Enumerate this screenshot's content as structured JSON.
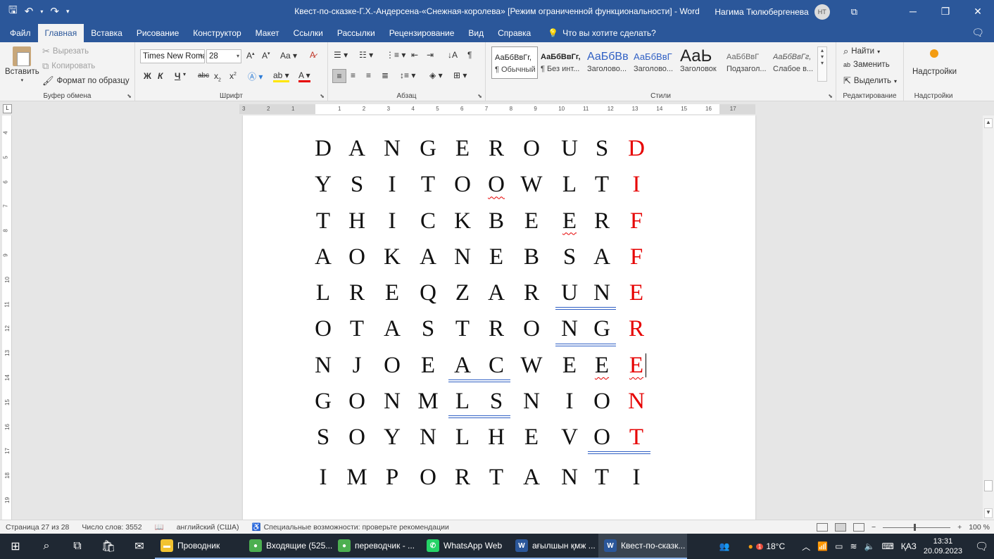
{
  "window": {
    "title": "Квест-по-сказке-Г.Х.-Андерсена-«Снежная-королева» [Режим ограниченной функциональности]  -  Word",
    "user_name": "Нагима Тюлюбергенева",
    "user_initials": "НТ"
  },
  "tabs": [
    "Файл",
    "Главная",
    "Вставка",
    "Рисование",
    "Конструктор",
    "Макет",
    "Ссылки",
    "Рассылки",
    "Рецензирование",
    "Вид",
    "Справка"
  ],
  "tell_me": "Что вы хотите сделать?",
  "clipboard": {
    "paste": "Вставить",
    "cut": "Вырезать",
    "copy": "Копировать",
    "format_painter": "Формат по образцу",
    "label": "Буфер обмена"
  },
  "font": {
    "name": "Times New Roman",
    "size": "28",
    "bold": "Ж",
    "italic": "К",
    "underline": "Ч",
    "strike": "abc",
    "label": "Шрифт"
  },
  "paragraph": {
    "label": "Абзац"
  },
  "styles": {
    "label": "Стили",
    "items": [
      {
        "sample": "АаБбВвГг,",
        "name": "¶ Обычный"
      },
      {
        "sample": "АаБбВвГг,",
        "name": "¶ Без инт..."
      },
      {
        "sample": "АаБбВв",
        "name": "Заголово..."
      },
      {
        "sample": "АаБбВвГ",
        "name": "Заголово..."
      },
      {
        "sample": "АаЬ",
        "name": "Заголовок"
      },
      {
        "sample": "АаБбВвГ",
        "name": "Подзагол..."
      },
      {
        "sample": "АаБбВвГг,",
        "name": "Слабое в..."
      }
    ]
  },
  "editing": {
    "find": "Найти",
    "replace": "Заменить",
    "select": "Выделить",
    "label": "Редактирование"
  },
  "addins": {
    "button": "Надстройки",
    "label": "Надстройки"
  },
  "ruler": {
    "top_ticks": [
      "3",
      "2",
      "1",
      "1",
      "2",
      "3",
      "4",
      "5",
      "6",
      "7",
      "8",
      "9",
      "10",
      "11",
      "12",
      "13",
      "14",
      "15",
      "16",
      "17"
    ],
    "left_ticks": [
      "4",
      "5",
      "6",
      "7",
      "8",
      "9",
      "10",
      "11",
      "12",
      "13",
      "14",
      "15",
      "16",
      "17",
      "18",
      "19"
    ]
  },
  "puzzle": {
    "rows": [
      [
        "D",
        "A",
        "N",
        "G",
        "E",
        "R",
        "O",
        "U",
        "S",
        "D"
      ],
      [
        "Y",
        "S",
        "I",
        "T",
        "O",
        "O",
        "W",
        "L",
        "T",
        "I"
      ],
      [
        "T",
        "H",
        "I",
        "C",
        "K",
        "B",
        "E",
        "E",
        "R",
        "F"
      ],
      [
        "A",
        "O",
        "K",
        "A",
        "N",
        "E",
        "B",
        "S",
        "A",
        "F"
      ],
      [
        "L",
        "R",
        "E",
        "Q",
        "Z",
        "A",
        "R",
        "U",
        "N",
        "E"
      ],
      [
        "O",
        "T",
        "A",
        "S",
        "T",
        "R",
        "O",
        "N",
        "G",
        "R"
      ],
      [
        "N",
        "J",
        "O",
        "E",
        "A",
        "C",
        "W",
        "E",
        "E",
        "E"
      ],
      [
        "G",
        "O",
        "N",
        "M",
        "L",
        "S",
        "N",
        "I",
        "O",
        "N"
      ],
      [
        "S",
        "O",
        "Y",
        "N",
        "L",
        "H",
        "E",
        "V",
        "O",
        "T"
      ],
      [
        "I",
        "M",
        "P",
        "O",
        "R",
        "T",
        "A",
        "N",
        "T",
        "I"
      ]
    ],
    "highlight_column": 9,
    "highlight_color": "#e60000"
  },
  "status": {
    "page": "Страница 27 из 28",
    "words": "Число слов: 3552",
    "language": "английский (США)",
    "accessibility": "Специальные возможности: проверьте рекомендации",
    "zoom": "100 %"
  },
  "taskbar": {
    "apps": [
      {
        "label": "Проводник",
        "color": "#f2c230",
        "glyph": "▬"
      },
      {
        "label": "Входящие (525...",
        "color": "#4caf50",
        "glyph": "●"
      },
      {
        "label": "переводчик - ...",
        "color": "#4caf50",
        "glyph": "●"
      },
      {
        "label": "WhatsApp Web",
        "color": "#25d366",
        "glyph": "✆"
      },
      {
        "label": "ағылшын қмж ...",
        "color": "#2b579a",
        "glyph": "W"
      },
      {
        "label": "Квест-по-сказк...",
        "color": "#2b579a",
        "glyph": "W"
      }
    ],
    "weather": "18°C",
    "weather_badge": "1",
    "language": "ҚАЗ",
    "time": "13:31",
    "date": "20.09.2023"
  }
}
